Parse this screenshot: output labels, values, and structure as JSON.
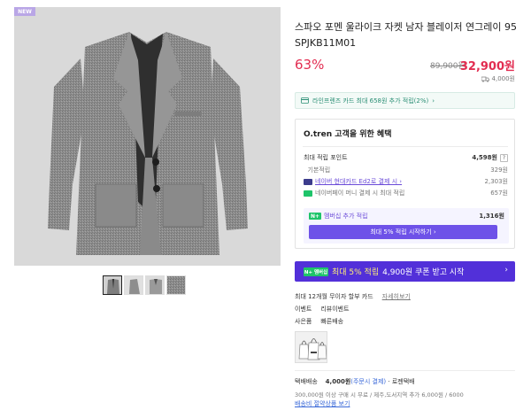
{
  "product": {
    "badge": "NEW",
    "title": "스파오 포멘 울라이크 자켓 남자 블레이저 연그레이 95 SPJKB11M01",
    "discount": "63%",
    "original_price": "89,900원",
    "price": "32,900원",
    "shipping_fee": "4,000원"
  },
  "card_promo": {
    "text": "라인프렌즈 카드 최대 658원 추가 적립(2%)",
    "chevron": "›"
  },
  "benefits": {
    "title": "O.tren 고객을 위한 혜택",
    "max_points_label": "최대 적립 포인트",
    "max_points_value": "4,598원",
    "help_mark": "?",
    "rows": [
      {
        "label": "기본적립",
        "value": "329원"
      },
      {
        "label": "네이버 현대카드 Ed2로 결제 시 ›",
        "value": "2,303원"
      },
      {
        "label": "네이버페이 머니 결제 시 최대 적립",
        "value": "657원"
      }
    ],
    "membership": {
      "badge": "N+",
      "label": "멤버십 추가 적립",
      "value": "1,316원",
      "button": "최대 5% 적립 시작하기 ›"
    }
  },
  "coupon_banner": {
    "badge": "N+ 멤버십",
    "highlight": "최대 5% 적립",
    "text": "4,900원 쿠폰 받고 시작",
    "chevron": "›"
  },
  "installment": {
    "label": "최대 12개월 무이자 할부 카드",
    "link": "자세히보기"
  },
  "event": {
    "label": "이벤트",
    "value": "리뷰이벤트"
  },
  "gift": {
    "label": "사은품",
    "value": "빠른배송"
  },
  "shipping": {
    "label": "택배배송",
    "fee": "4,000원",
    "note": "(주문시 결제)",
    "sep": "·",
    "courier": "로젠택배",
    "condition": "300,000원 이상 구매 시 무료 / 제주,도서지역 추가 6,000원 / 6000",
    "link": "배송비 절약상품 보기"
  },
  "colors": {
    "accent_red": "#e22d51",
    "accent_purple": "#6e52e8",
    "banner": "#5230d9",
    "green": "#2a8e74"
  }
}
